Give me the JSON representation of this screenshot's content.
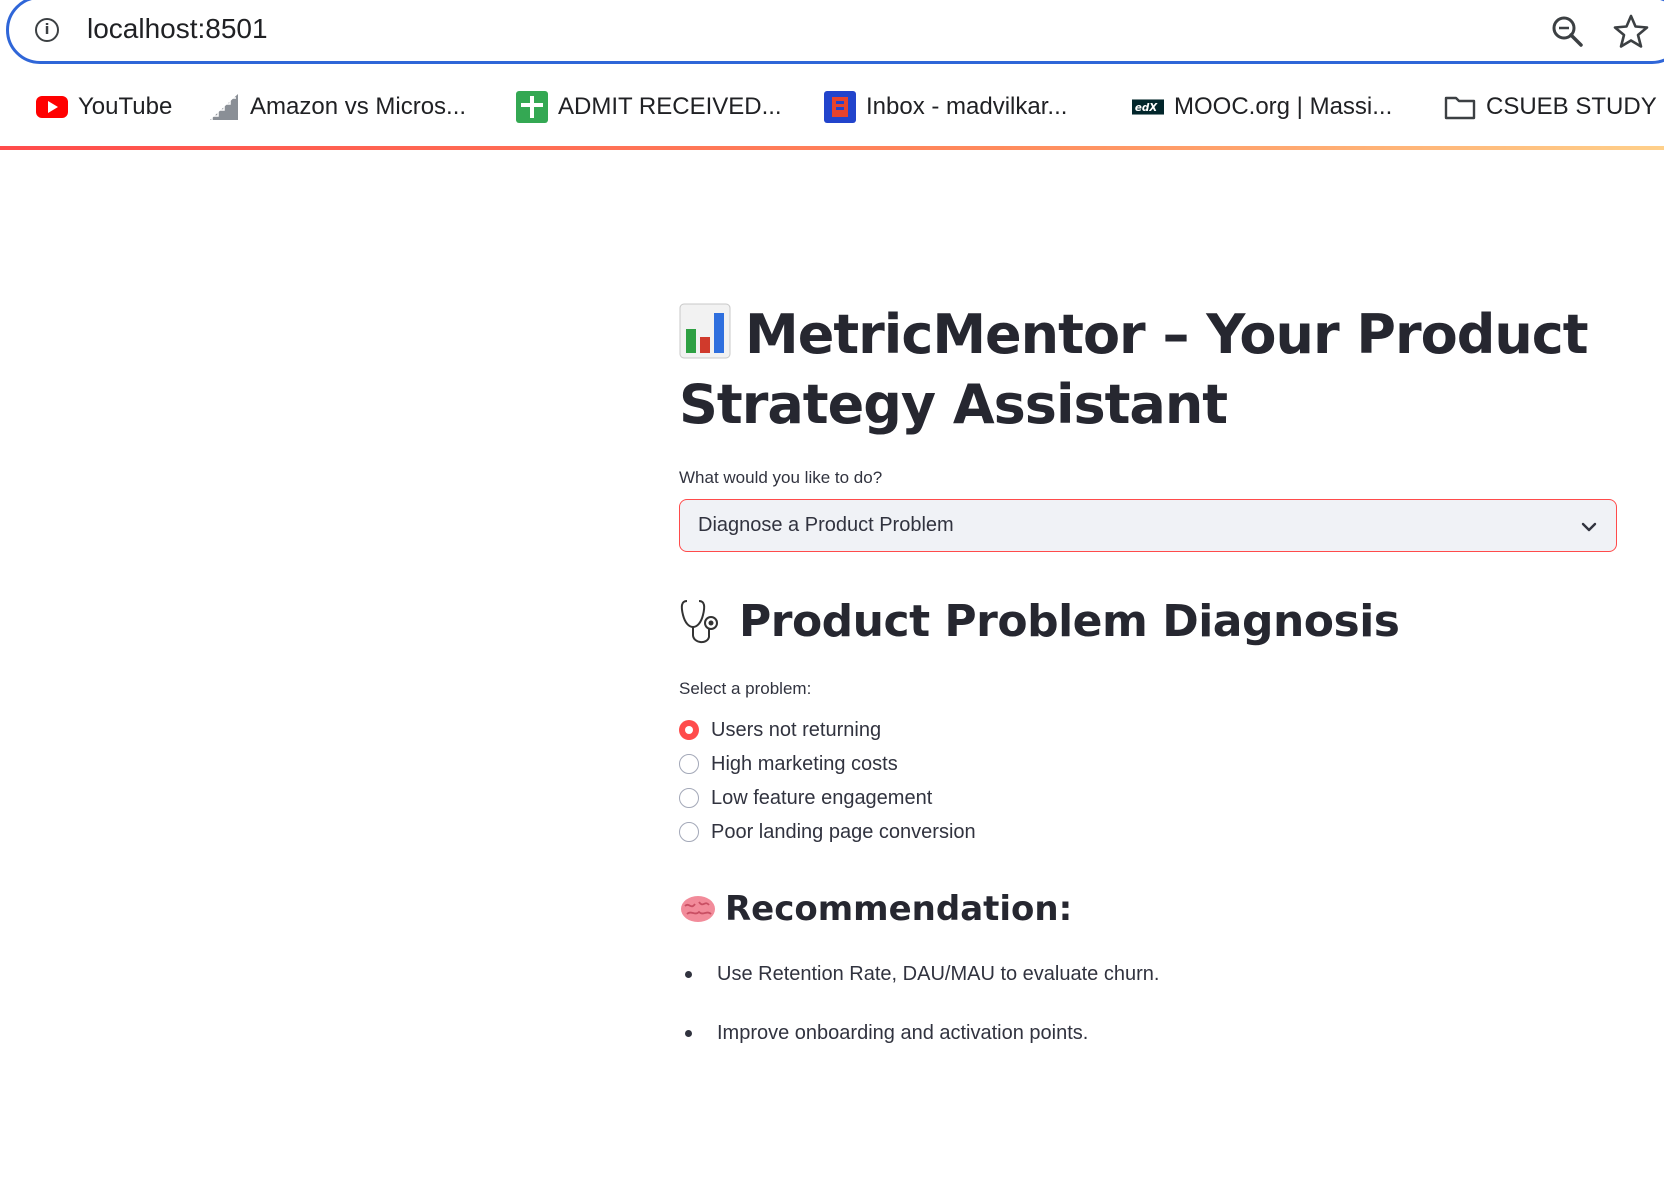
{
  "browser": {
    "url": "localhost:8501",
    "bookmarks": [
      {
        "label": "YouTube",
        "icon": "youtube-icon"
      },
      {
        "label": "Amazon vs Micros...",
        "icon": "staircase-icon"
      },
      {
        "label": "ADMIT RECEIVED...",
        "icon": "plus-sheet-icon"
      },
      {
        "label": "Inbox - madvilkar...",
        "icon": "mail-app-icon"
      },
      {
        "label": "MOOC.org | Massi...",
        "icon": "edx-icon"
      },
      {
        "label": "CSUEB STUDY",
        "icon": "folder-icon"
      }
    ]
  },
  "app": {
    "title": "MetricMentor – Your Product Strategy Assistant",
    "title_icon": "bar-chart-emoji",
    "select_label": "What would you like to do?",
    "select_value": "Diagnose a Product Problem",
    "section_title": "Product Problem Diagnosis",
    "section_icon": "stethoscope-emoji",
    "radio_label": "Select a problem:",
    "radio_options": [
      {
        "label": "Users not returning",
        "checked": true
      },
      {
        "label": "High marketing costs",
        "checked": false
      },
      {
        "label": "Low feature engagement",
        "checked": false
      },
      {
        "label": "Poor landing page conversion",
        "checked": false
      }
    ],
    "recommendation_title": "Recommendation:",
    "recommendation_icon": "brain-emoji",
    "recommendations": [
      "Use Retention Rate, DAU/MAU to evaluate churn.",
      "Improve onboarding and activation points."
    ]
  },
  "colors": {
    "accent": "#ff4b4b",
    "text": "#31333f",
    "urlbar_border": "#2f66d8",
    "select_bg": "#f0f2f6"
  }
}
